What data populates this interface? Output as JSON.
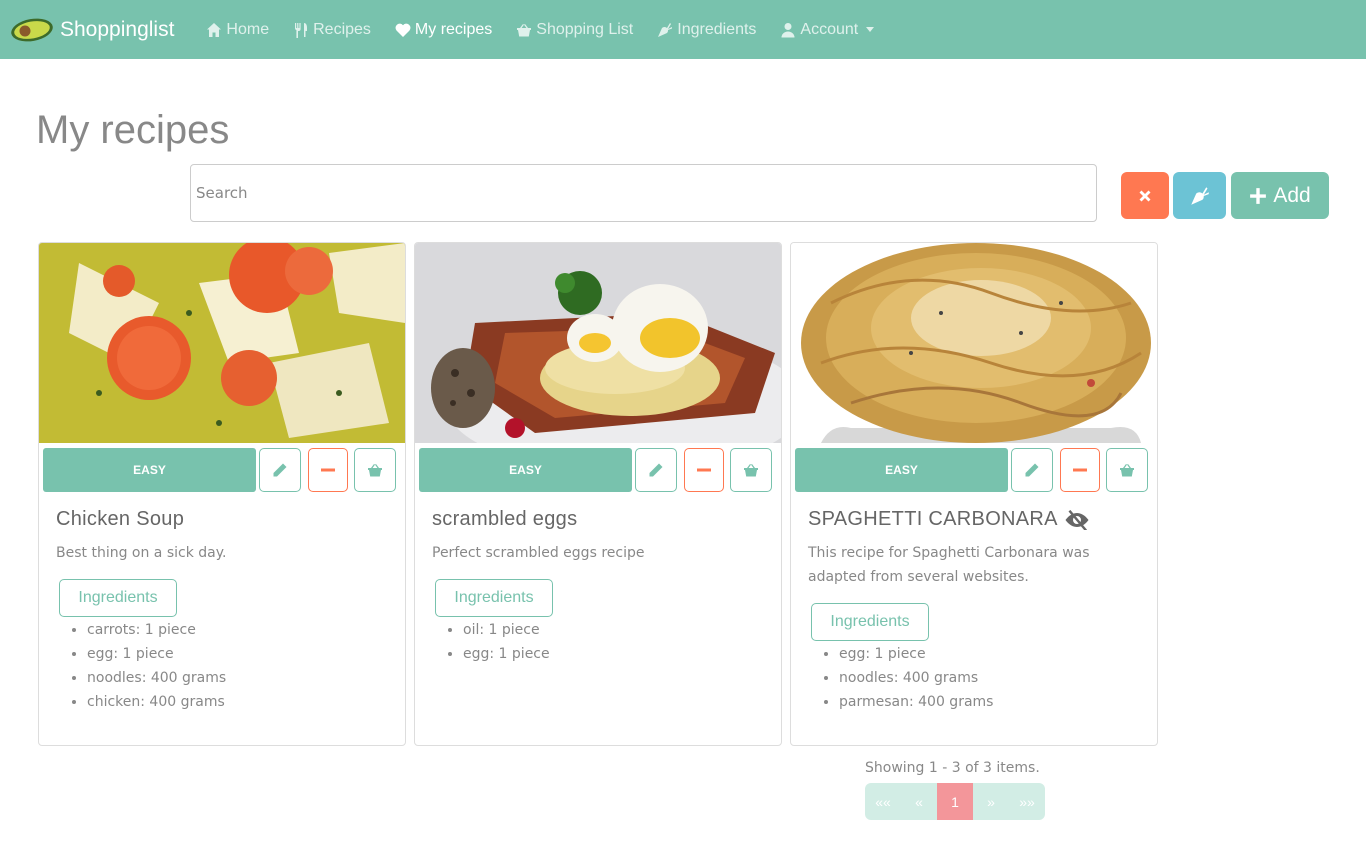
{
  "navbar": {
    "brand": "Shoppinglist",
    "items": [
      {
        "label": "Home",
        "icon": "home-icon"
      },
      {
        "label": "Recipes",
        "icon": "utensils-icon"
      },
      {
        "label": "My recipes",
        "icon": "heart-icon"
      },
      {
        "label": "Shopping List",
        "icon": "basket-icon"
      },
      {
        "label": "Ingredients",
        "icon": "carrot-icon"
      },
      {
        "label": "Account",
        "icon": "user-icon"
      }
    ],
    "active": "My recipes",
    "color": "#78c2ad"
  },
  "page": {
    "title": "My recipes",
    "search_placeholder": "Search",
    "add_label": "Add"
  },
  "recipes": [
    {
      "title": "Chicken Soup",
      "difficulty": "EASY",
      "description": "Best thing on a sick day.",
      "ingredients_label": "Ingredients",
      "ingredients": [
        "carrots: 1 piece",
        "egg: 1 piece",
        "noodles: 400 grams",
        "chicken: 400 grams"
      ]
    },
    {
      "title": "scrambled eggs",
      "difficulty": "EASY",
      "description": "Perfect scrambled eggs recipe",
      "ingredients_label": "Ingredients",
      "ingredients": [
        "oil: 1 piece",
        "egg: 1 piece"
      ]
    },
    {
      "title": "SPAGHETTI CARBONARA",
      "hidden_icon": "eye-slash-icon",
      "difficulty": "EASY",
      "description_line1": "This recipe for Spaghetti Carbonara was",
      "description_line2": "adapted from several websites.",
      "ingredients_label": "Ingredients",
      "ingredients": [
        "egg: 1 piece",
        "noodles: 400 grams",
        "parmesan: 400 grams"
      ]
    }
  ],
  "pagination": {
    "summary": "Showing 1 - 3 of 3 items.",
    "first": "««",
    "prev": "«",
    "current": "1",
    "next": "»",
    "last": "»»"
  },
  "colors": {
    "primary": "#78c2ad",
    "danger": "#ff7851",
    "info": "#6cc3d5",
    "active_page": "#f3969a"
  }
}
